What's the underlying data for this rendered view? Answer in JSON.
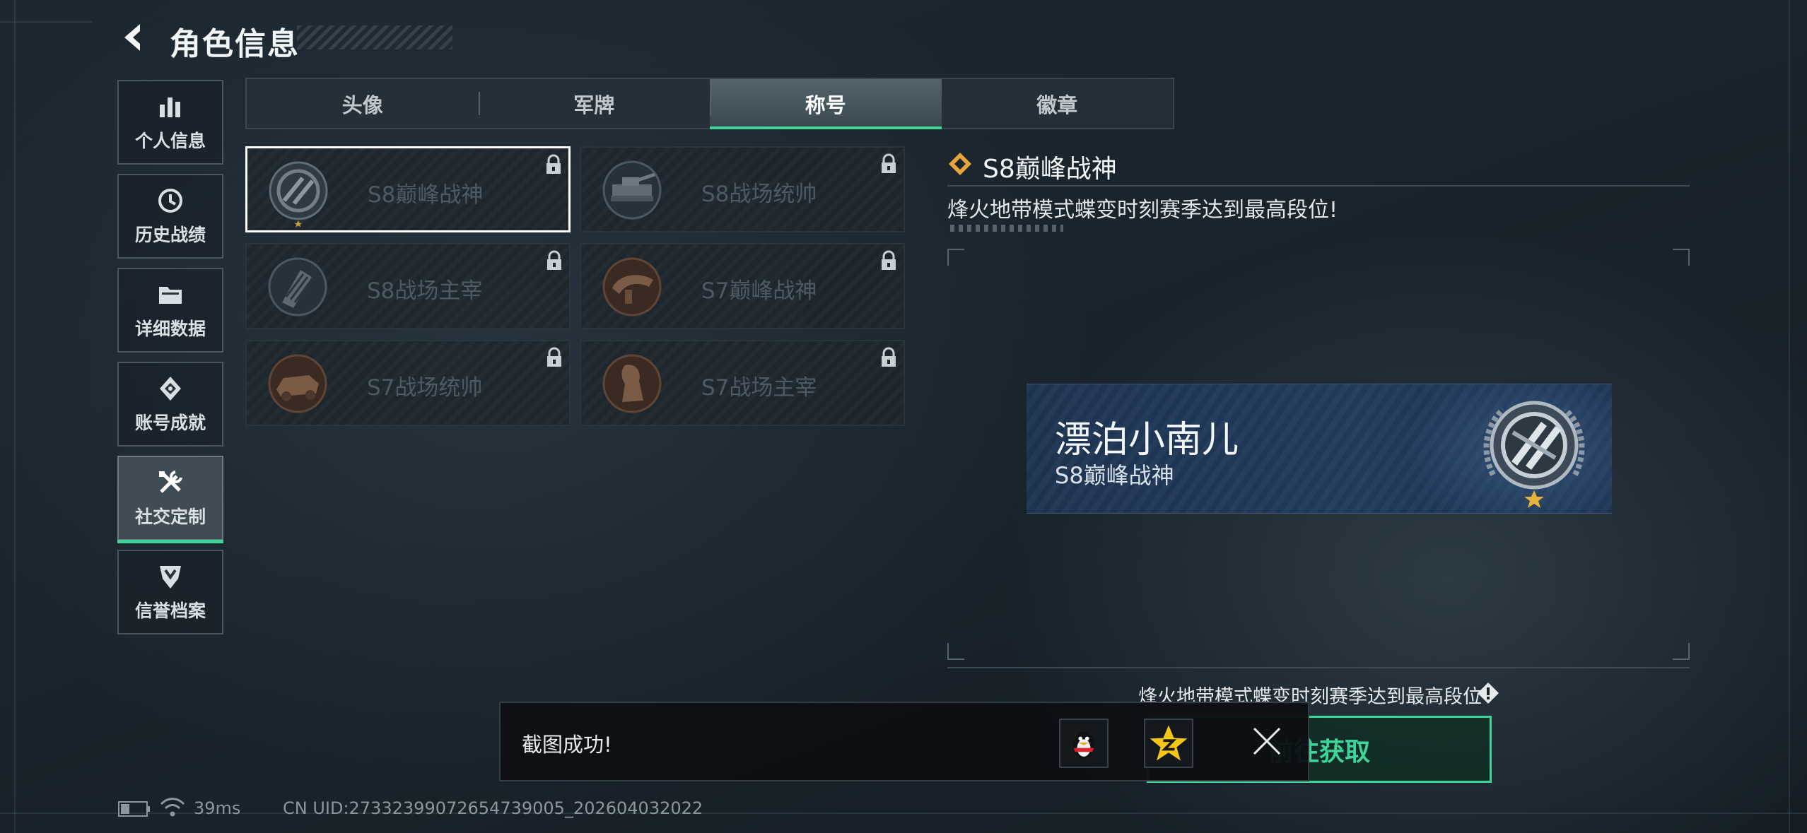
{
  "header": {
    "title": "角色信息"
  },
  "sidebar": {
    "items": [
      {
        "label": "个人信息",
        "icon": "bar-chart-icon"
      },
      {
        "label": "历史战绩",
        "icon": "history-clock-icon"
      },
      {
        "label": "详细数据",
        "icon": "folder-icon"
      },
      {
        "label": "账号成就",
        "icon": "achievement-icon"
      },
      {
        "label": "社交定制",
        "icon": "tools-icon",
        "active": true
      },
      {
        "label": "信誉档案",
        "icon": "credit-shield-icon"
      }
    ]
  },
  "tabs": [
    {
      "label": "头像"
    },
    {
      "label": "军牌"
    },
    {
      "label": "称号",
      "active": true
    },
    {
      "label": "徽章"
    }
  ],
  "titles": [
    {
      "label": "S8巅峰战神",
      "locked": true,
      "selected": true
    },
    {
      "label": "S8战场统帅",
      "locked": true
    },
    {
      "label": "S8战场主宰",
      "locked": true
    },
    {
      "label": "S7巅峰战神",
      "locked": true
    },
    {
      "label": "S7战场统帅",
      "locked": true
    },
    {
      "label": "S7战场主宰",
      "locked": true
    }
  ],
  "detail": {
    "title": "S8巅峰战神",
    "description": "烽火地带模式蝶变时刻赛季达到最高段位!"
  },
  "nameplate": {
    "player_name": "漂泊小南儿",
    "title": "S8巅峰战神"
  },
  "requirement": {
    "text": "烽火地带模式蝶变时刻赛季达到最高段位"
  },
  "goto_button": {
    "label": "前往获取"
  },
  "toast": {
    "text": "截图成功!"
  },
  "status": {
    "ping": "39ms",
    "uid": "CN UID:27332399072654739005_202604032022"
  },
  "colors": {
    "accent": "#3fd49a",
    "gold": "#e6a43a",
    "nameplate_bg": "#1f3858"
  }
}
